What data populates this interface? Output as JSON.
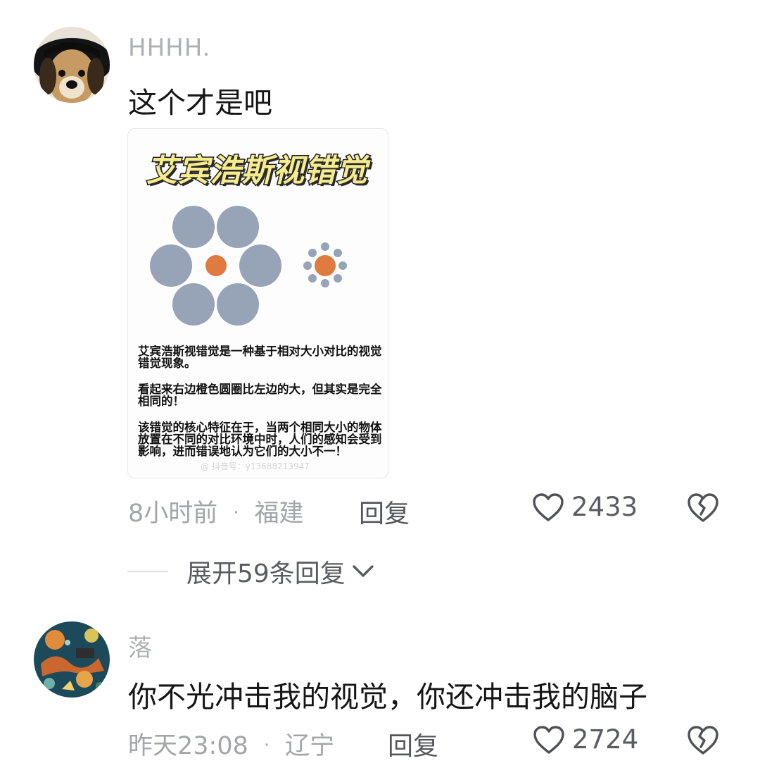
{
  "comments": [
    {
      "username": "HHHH.",
      "text": "这个才是吧",
      "image": {
        "title": "艾宾浩斯视错觉",
        "paragraphs": [
          "艾宾浩斯视错觉是一种基于相对大小对比的视觉错觉现象。",
          "看起来右边橙色圆圈比左边的大，但其实是完全相同的！",
          "该错觉的核心特征在于，当两个相同大小的物体放置在不同的对比环境中时，人们的感知会受到影响，进而错误地认为它们的大小不一！"
        ],
        "watermark": "@ 抖音号：y13688213947",
        "colors": {
          "big_circles": "#97a3b6",
          "center_circle": "#e07b3f",
          "title_fill": "#f6ec8e"
        }
      },
      "time": "8小时前",
      "location": "福建",
      "reply_label": "回复",
      "likes": "2433",
      "avatar_icon": "puppy-avatar"
    },
    {
      "username": "落",
      "text": "你不光冲击我的视觉，你还冲击我的脑子",
      "time": "昨天23:08",
      "location": "辽宁",
      "reply_label": "回复",
      "likes": "2724",
      "avatar_icon": "album-art-avatar"
    }
  ],
  "expand_replies": {
    "label": "展开59条回复",
    "icon": "chevron-down-icon"
  },
  "icons": {
    "like": "heart-outline-icon",
    "dislike": "broken-heart-icon"
  },
  "colors": {
    "username": "#aeb0b5",
    "meta": "#a3a5aa",
    "text": "#161616"
  }
}
